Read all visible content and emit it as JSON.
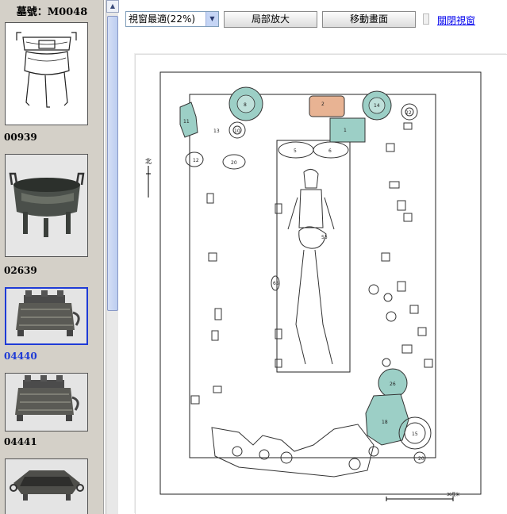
{
  "sidebar": {
    "title": "墓號：M0048",
    "thumbnails": [
      {
        "label": "00939",
        "selected": false,
        "kind": "line-drawing"
      },
      {
        "label": "02639",
        "selected": false,
        "kind": "photo-bowl"
      },
      {
        "label": "04440",
        "selected": true,
        "kind": "photo-box"
      },
      {
        "label": "04441",
        "selected": false,
        "kind": "photo-box"
      },
      {
        "label": "",
        "selected": false,
        "kind": "photo-tray"
      }
    ]
  },
  "toolbar": {
    "zoom_value": "視窗最適(22%)",
    "partial_zoom_label": "局部放大",
    "move_label": "移動畫面",
    "close_label": "關閉視窗"
  },
  "plan": {
    "north_label": "北",
    "scale_label": "30厘米",
    "highlight_teal": "#9ccfc6",
    "highlight_orange": "#e8b393"
  },
  "colors": {
    "sidebar_bg": "#d4d0c8",
    "selected_blue": "#1f3bd6",
    "link_blue": "#0000ee"
  }
}
